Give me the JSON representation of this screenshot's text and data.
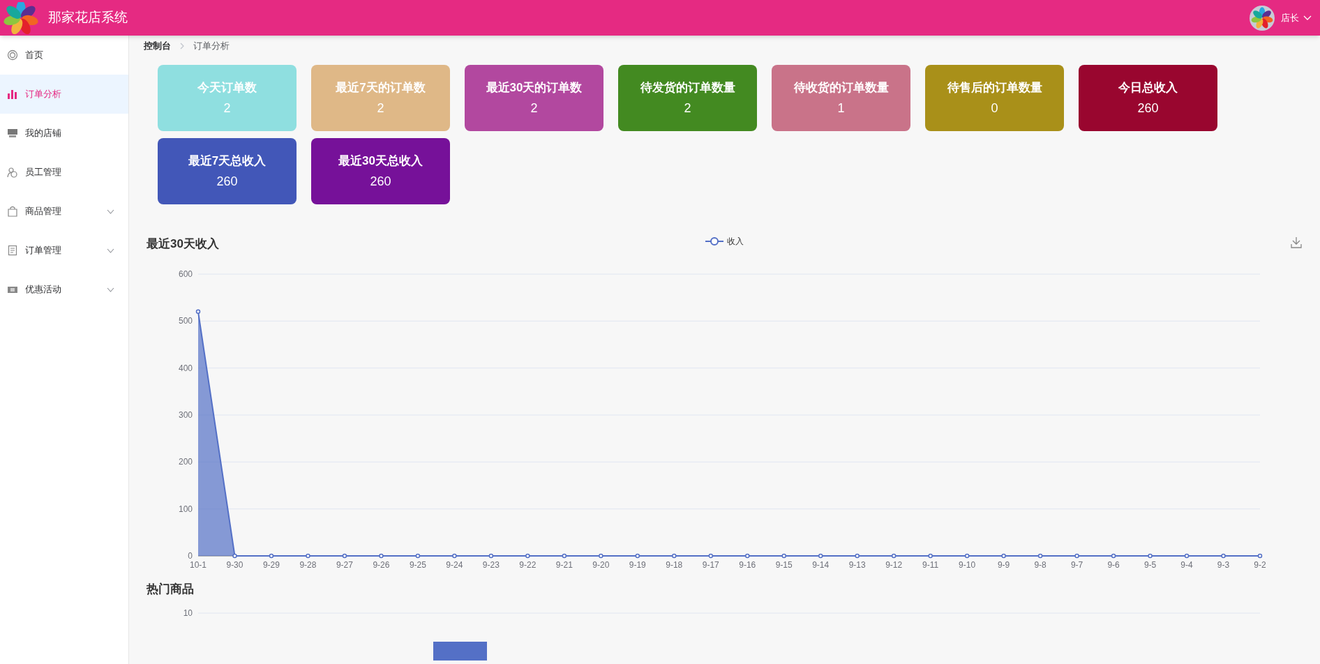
{
  "header": {
    "title": "那家花店系统",
    "user": "店长"
  },
  "sidebar": {
    "items": [
      {
        "label": "首页",
        "selected": false
      },
      {
        "label": "订单分析",
        "selected": true
      },
      {
        "label": "我的店铺",
        "selected": false
      },
      {
        "label": "员工管理",
        "selected": false
      },
      {
        "label": "商品管理",
        "selected": false,
        "expanded": false
      },
      {
        "label": "订单管理",
        "selected": false,
        "expanded": false
      },
      {
        "label": "优惠活动",
        "selected": false,
        "expanded": false
      }
    ]
  },
  "breadcrumb": [
    "控制台",
    "订单分析"
  ],
  "stat_cards": [
    {
      "title": "今天订单数",
      "value": "2",
      "color": "#8fdfe0"
    },
    {
      "title": "最近7天的订单数",
      "value": "2",
      "color": "#dfb887"
    },
    {
      "title": "最近30天的订单数",
      "value": "2",
      "color": "#b2489f"
    },
    {
      "title": "待发货的订单数量",
      "value": "2",
      "color": "#438a21"
    },
    {
      "title": "待收货的订单数量",
      "value": "1",
      "color": "#c97389"
    },
    {
      "title": "待售后的订单数量",
      "value": "0",
      "color": "#a99019"
    },
    {
      "title": "今日总收入",
      "value": "260",
      "color": "#99062f"
    },
    {
      "title": "最近7天总收入",
      "value": "260",
      "color": "#4257b8"
    },
    {
      "title": "最近30天总收入",
      "value": "260",
      "color": "#761199"
    }
  ],
  "income_chart": {
    "title": "最近30天收入",
    "chart_data": {
      "type": "area",
      "categories": [
        "10-1",
        "9-30",
        "9-29",
        "9-28",
        "9-27",
        "9-26",
        "9-25",
        "9-24",
        "9-23",
        "9-22",
        "9-21",
        "9-20",
        "9-19",
        "9-18",
        "9-17",
        "9-16",
        "9-15",
        "9-14",
        "9-13",
        "9-12",
        "9-11",
        "9-10",
        "9-9",
        "9-8",
        "9-7",
        "9-6",
        "9-5",
        "9-4",
        "9-3",
        "9-2"
      ],
      "series": [
        {
          "name": "收入",
          "color": "#5470c6",
          "values": [
            520,
            0,
            0,
            0,
            0,
            0,
            0,
            0,
            0,
            0,
            0,
            0,
            0,
            0,
            0,
            0,
            0,
            0,
            0,
            0,
            0,
            0,
            0,
            0,
            0,
            0,
            0,
            0,
            0,
            0
          ]
        }
      ],
      "grid": true,
      "ylim": [
        0,
        600
      ],
      "yticks": [
        0,
        100,
        200,
        300,
        400,
        500,
        600
      ]
    }
  },
  "hot_products": {
    "title": "热门商品",
    "axis_tick": "10"
  }
}
